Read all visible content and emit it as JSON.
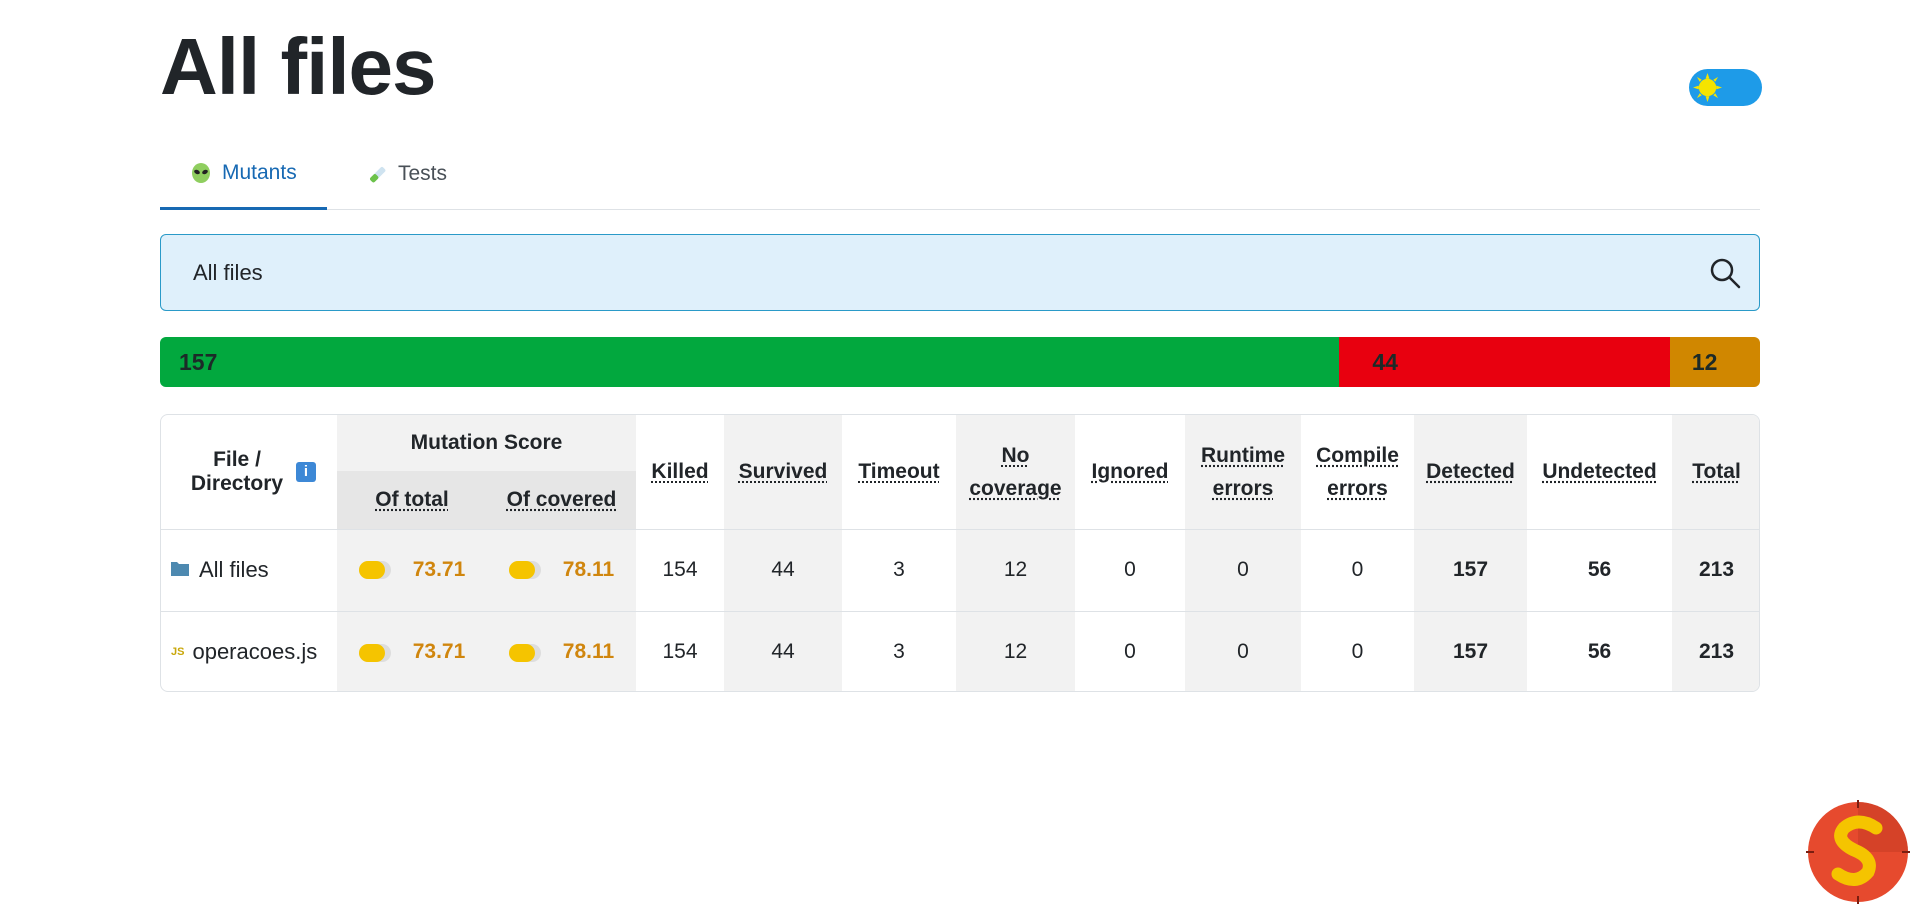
{
  "page": {
    "title": "All files"
  },
  "tabs": [
    {
      "label": "Mutants",
      "icon": "alien-icon",
      "active": true
    },
    {
      "label": "Tests",
      "icon": "test-tube-icon",
      "active": false
    }
  ],
  "search": {
    "placeholder": "All files"
  },
  "progress": {
    "killed": 157,
    "survived": 44,
    "no_coverage": 12,
    "colors": {
      "killed": "#02a83e",
      "survived": "#e8000f",
      "no_coverage": "#d08700"
    }
  },
  "table": {
    "headers": {
      "file": "File / Directory",
      "mutation_score": "Mutation Score",
      "of_total": "Of total",
      "of_covered": "Of covered",
      "killed": "Killed",
      "survived": "Survived",
      "timeout": "Timeout",
      "no_coverage": "No coverage",
      "ignored": "Ignored",
      "runtime_errors": "Runtime errors",
      "compile_errors": "Compile errors",
      "detected": "Detected",
      "undetected": "Undetected",
      "total": "Total"
    },
    "rows": [
      {
        "name": "All files",
        "icon": "folder-icon",
        "of_total": "73.71",
        "of_covered": "78.11",
        "killed": "154",
        "survived": "44",
        "timeout": "3",
        "no_coverage": "12",
        "ignored": "0",
        "runtime_errors": "0",
        "compile_errors": "0",
        "detected": "157",
        "undetected": "56",
        "total": "213"
      },
      {
        "name": "operacoes.js",
        "icon": "js-file-icon",
        "icon_text": "JS",
        "of_total": "73.71",
        "of_covered": "78.11",
        "killed": "154",
        "survived": "44",
        "timeout": "3",
        "no_coverage": "12",
        "ignored": "0",
        "runtime_errors": "0",
        "compile_errors": "0",
        "detected": "157",
        "undetected": "56",
        "total": "213"
      }
    ]
  },
  "colors": {
    "accent": "#1769b3",
    "warning_score": "#d0860e"
  }
}
